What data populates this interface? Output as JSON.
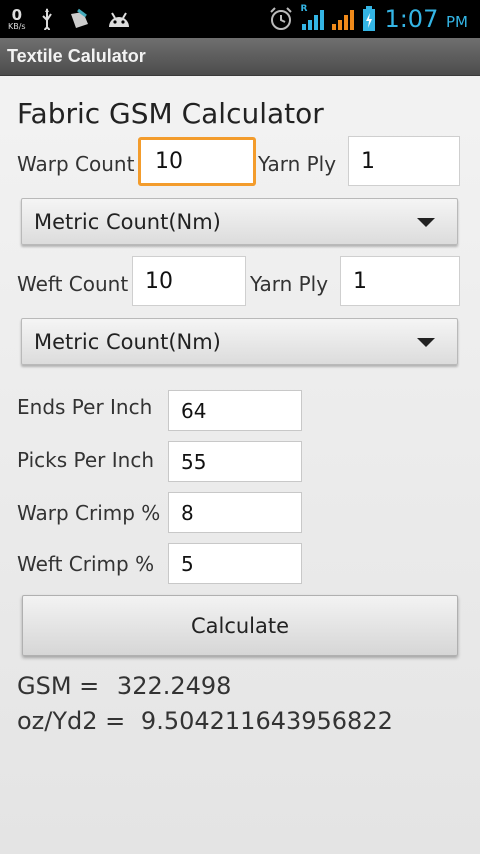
{
  "status_bar": {
    "net_speed": "0",
    "net_unit": "KB/s",
    "roaming_tag": "R",
    "time": "1:07",
    "ampm": "PM",
    "icons": [
      "usb-icon",
      "debug-icon",
      "android-icon",
      "alarm-icon",
      "wifi-signal-icon",
      "cell-signal-icon",
      "battery-icon"
    ]
  },
  "app": {
    "title": "Textile Calulator"
  },
  "form": {
    "heading": "Fabric GSM Calculator",
    "warp_count_label": "Warp Count",
    "warp_count_value": "10",
    "warp_ply_label": "Yarn Ply",
    "warp_ply_value": "1",
    "warp_unit": "Metric Count(Nm)",
    "weft_count_label": "Weft Count",
    "weft_count_value": "10",
    "weft_ply_label": "Yarn Ply",
    "weft_ply_value": "1",
    "weft_unit": "Metric Count(Nm)",
    "epi_label": "Ends Per Inch",
    "epi_value": "64",
    "ppi_label": "Picks Per Inch",
    "ppi_value": "55",
    "warp_crimp_label": "Warp Crimp %",
    "warp_crimp_value": "8",
    "weft_crimp_label": "Weft Crimp %",
    "weft_crimp_value": "5",
    "calculate_label": "Calculate"
  },
  "results": {
    "gsm_label": "GSM =",
    "gsm_value": "322.2498",
    "oz_label": "oz/Yd2 =",
    "oz_value": "9.504211643956822"
  },
  "colors": {
    "focus_border": "#f39c2c",
    "clock": "#34b5e5",
    "title_bar": "#5a5a5a"
  }
}
